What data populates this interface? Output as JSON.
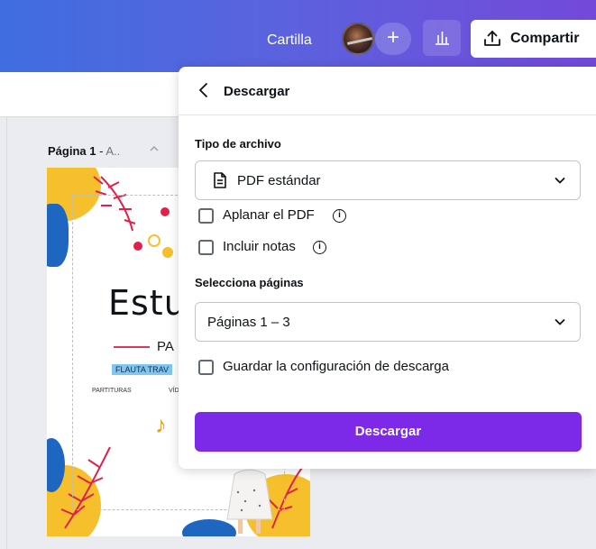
{
  "header": {
    "doc_title": "Cartilla",
    "add_label": "+",
    "share_label": "Compartir"
  },
  "canvas": {
    "page_label_bold": "Página 1",
    "page_label_sep": " - ",
    "page_label_rest": "A..",
    "design": {
      "title": "Estu",
      "subtitle": "PA",
      "tag": "FLAUTA TRAV",
      "small_left": "PARTITURAS",
      "small_right": "VÍD",
      "note": "♪"
    }
  },
  "panel": {
    "title": "Descargar",
    "file_type_label": "Tipo de archivo",
    "file_type_value": "PDF estándar",
    "flatten_label": "Aplanar el PDF",
    "notes_label": "Incluir notas",
    "pages_label": "Selecciona páginas",
    "pages_value": "Páginas 1 – 3",
    "save_settings_label": "Guardar la configuración de descarga",
    "download_button": "Descargar"
  },
  "colors": {
    "accent": "#7d2ae8",
    "header_start": "#3f6ee0",
    "header_end": "#7349d9"
  }
}
